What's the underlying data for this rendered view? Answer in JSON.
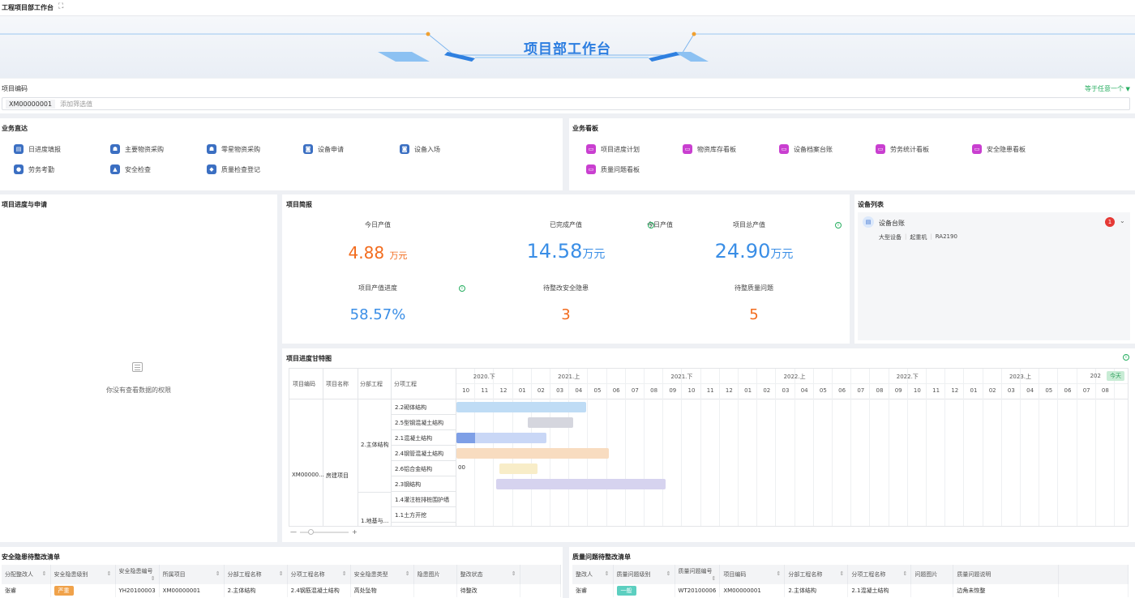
{
  "app": {
    "title": "工程项目部工作台",
    "expand_icon": "expand-icon"
  },
  "banner": {
    "title": "项目部工作台"
  },
  "filter": {
    "label": "项目编码",
    "tag": "XM00000001",
    "placeholder": "添加筛选值",
    "mode": "等于任意一个"
  },
  "business": {
    "title": "业务直达",
    "items": [
      "日进度填报",
      "主要物资采购",
      "零星物资采购",
      "设备申请",
      "设备入场",
      "劳务考勤",
      "安全检查",
      "质量检查登记"
    ]
  },
  "board": {
    "title": "业务看板",
    "items": [
      "项目进度计划",
      "物资库存看板",
      "设备档案台账",
      "劳务统计看板",
      "安全隐患看板",
      "质量问题看板"
    ]
  },
  "progress_apply": {
    "title": "项目进度与申请",
    "empty_text": "你没有查看数据的权限"
  },
  "report": {
    "title": "项目简报",
    "today_label": "今日产值",
    "today_value": "4.88",
    "today_unit": "万元",
    "done_label": "已完成产值",
    "done_value": "14.58",
    "done_unit": "万元",
    "total_label": "项目总产值",
    "total_value": "24.90",
    "total_unit": "万元",
    "rate_label": "项目产值进度",
    "rate_value": "58.57%",
    "safety_label": "待整改安全隐患",
    "safety_value": "3",
    "quality_label": "待整质量问题",
    "quality_value": "5"
  },
  "equipment": {
    "title": "设备列表",
    "item": "设备台账",
    "badge": "1",
    "tags": [
      "大型设备",
      "起重机",
      "RA2190"
    ]
  },
  "gantt": {
    "title": "项目进度甘特图",
    "headers": [
      "项目编码",
      "项目名称",
      "分部工程",
      "分项工程"
    ],
    "project_code": "XM00000...",
    "project_name": "房建项目",
    "part1": "2.主体结构",
    "part2": "1.地基与...",
    "tasks": [
      "2.2砌体结构",
      "2.5型钢混凝土结构",
      "2.1混凝土结构",
      "2.4钢管混凝土结构",
      "2.6铝合金结构",
      "2.3钢结构",
      "1.4灌注桩排桩围护墙",
      "1.1土方开挖"
    ],
    "periods": [
      "2020.下",
      "2021.上",
      "2021.下",
      "2022.上",
      "2022.下",
      "2023.上",
      "202"
    ],
    "months": [
      "10",
      "11",
      "12",
      "01",
      "02",
      "03",
      "04",
      "05",
      "06",
      "07",
      "08",
      "09",
      "10",
      "11",
      "12",
      "01",
      "02",
      "03",
      "04",
      "05",
      "06",
      "07",
      "08",
      "09",
      "10",
      "11",
      "12",
      "01",
      "02",
      "03",
      "04",
      "05",
      "06",
      "07",
      "08"
    ],
    "today": "今天",
    "extra_label": "00",
    "zoom_minus": "—",
    "zoom_plus": "+"
  },
  "safety_list": {
    "title": "安全隐患待整改清单",
    "columns": [
      "分配整改人",
      "安全隐患级别",
      "安全隐患编号",
      "所属项目",
      "分部工程名称",
      "分项工程名称",
      "安全隐患类型",
      "隐患图片",
      "整改状态"
    ],
    "rows": [
      [
        "张睿",
        "严重",
        "YH20100003",
        "XM00000001",
        "2.主体结构",
        "2.4钢筋混凝土结构",
        "高处坠物",
        "",
        "待整改"
      ]
    ],
    "level_color": "#f0a24a"
  },
  "quality_list": {
    "title": "质量问题待整改清单",
    "columns": [
      "整改人",
      "质量问题级别",
      "质量问题编号",
      "项目编码",
      "分部工程名称",
      "分项工程名称",
      "问题图片",
      "质量问题说明"
    ],
    "rows": [
      [
        "张睿",
        "一般",
        "WT20100006",
        "XM00000001",
        "2.主体结构",
        "2.1混凝土结构",
        "",
        "边角未恢整"
      ]
    ],
    "level_color": "#5ccfc0"
  },
  "colors": {
    "accent": "#2b7de0",
    "orange": "#f26b1d",
    "blue_value": "#3a8ee6",
    "green": "#27ae60"
  }
}
